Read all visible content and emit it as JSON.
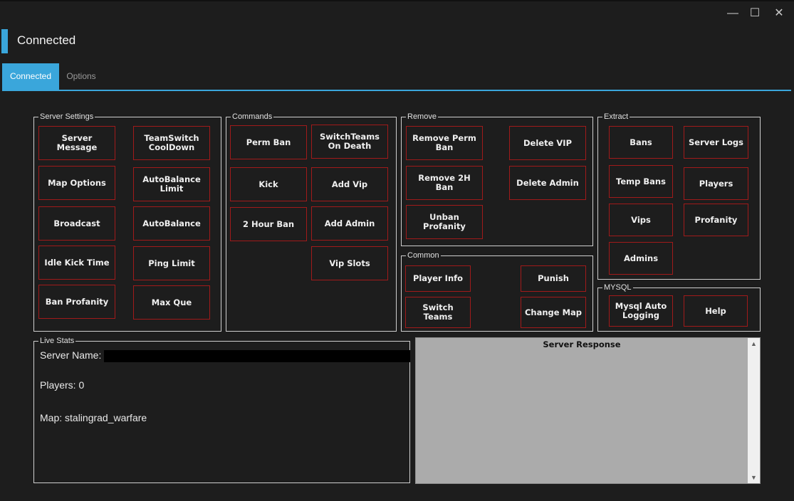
{
  "window": {
    "title": "Connected",
    "minimize_glyph": "—",
    "maximize_glyph": "☐",
    "close_glyph": "✕",
    "accent_color": "#3aa6db"
  },
  "tabs": [
    {
      "label": "Connected",
      "active": true
    },
    {
      "label": "Options",
      "active": false
    }
  ],
  "groups": {
    "server_settings": {
      "label": "Server Settings",
      "buttons": [
        "Server Message",
        "TeamSwitch CoolDown",
        "Map Options",
        "AutoBalance Limit",
        "Broadcast",
        "AutoBalance",
        "Idle Kick Time",
        "Ping Limit",
        "Ban Profanity",
        "Max Que"
      ]
    },
    "commands": {
      "label": "Commands",
      "buttons": [
        "Perm Ban",
        "SwitchTeams On Death",
        "Kick",
        "Add Vip",
        "2 Hour Ban",
        "Add Admin",
        "Vip Slots"
      ]
    },
    "remove": {
      "label": "Remove",
      "buttons": [
        "Remove Perm Ban",
        "Delete VIP",
        "Remove 2H Ban",
        "Delete Admin",
        "Unban Profanity"
      ]
    },
    "common": {
      "label": "Common",
      "buttons": [
        "Player Info",
        "Punish",
        "Switch Teams",
        "Change Map"
      ]
    },
    "extract": {
      "label": "Extract",
      "buttons": [
        "Bans",
        "Server Logs",
        "Temp Bans",
        "Players",
        "Vips",
        "Profanity",
        "Admins"
      ]
    },
    "mysql": {
      "label": "MYSQL",
      "buttons": [
        "Mysql Auto Logging",
        "Help"
      ]
    },
    "live_stats": {
      "label": "Live Stats",
      "server_name_label": "Server Name:",
      "players_line": "Players: 0",
      "map_line": "Map: stalingrad_warfare"
    }
  },
  "server_response": {
    "title": "Server Response",
    "scroll_up_glyph": "▲",
    "scroll_down_glyph": "▼"
  }
}
